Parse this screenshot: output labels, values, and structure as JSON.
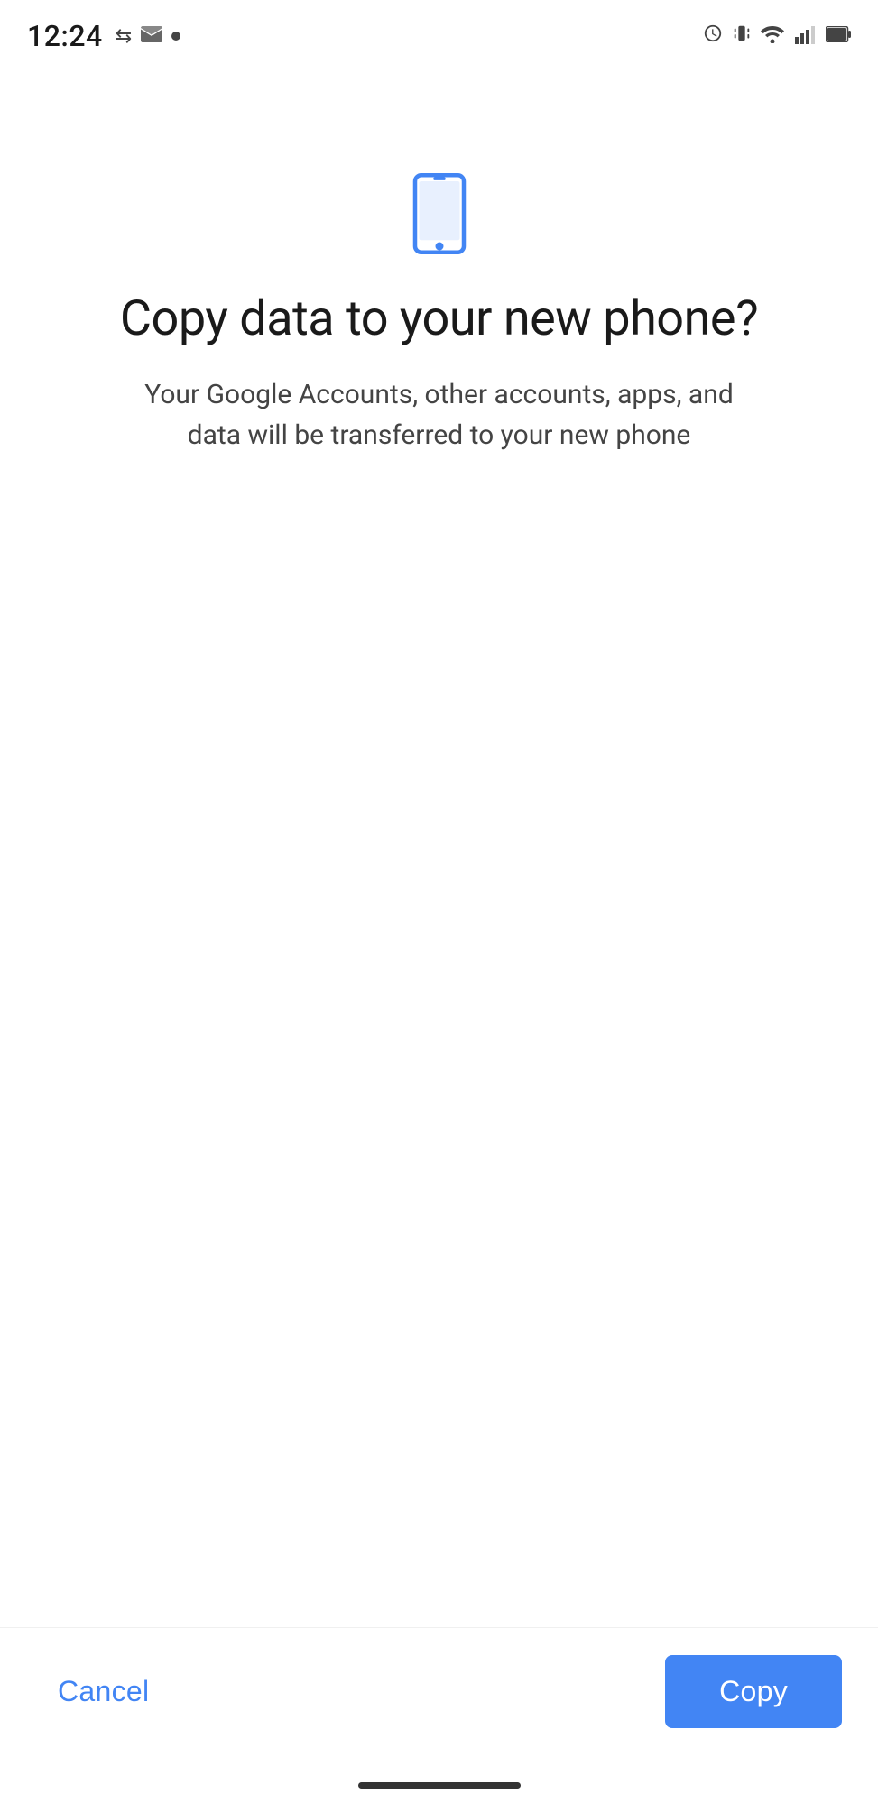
{
  "status_bar": {
    "time": "12:24",
    "icons": {
      "alarm": "⏰",
      "vibrate": "📳",
      "wifi": "wifi",
      "signal": "signal",
      "battery": "battery"
    }
  },
  "page": {
    "phone_icon_color": "#4285F4",
    "title": "Copy data to your new phone?",
    "subtitle": "Your Google Accounts, other accounts, apps, and data will be transferred to your new phone"
  },
  "actions": {
    "cancel_label": "Cancel",
    "copy_label": "Copy",
    "copy_button_color": "#4285F4",
    "copy_text_color": "#ffffff",
    "cancel_text_color": "#4285F4"
  }
}
